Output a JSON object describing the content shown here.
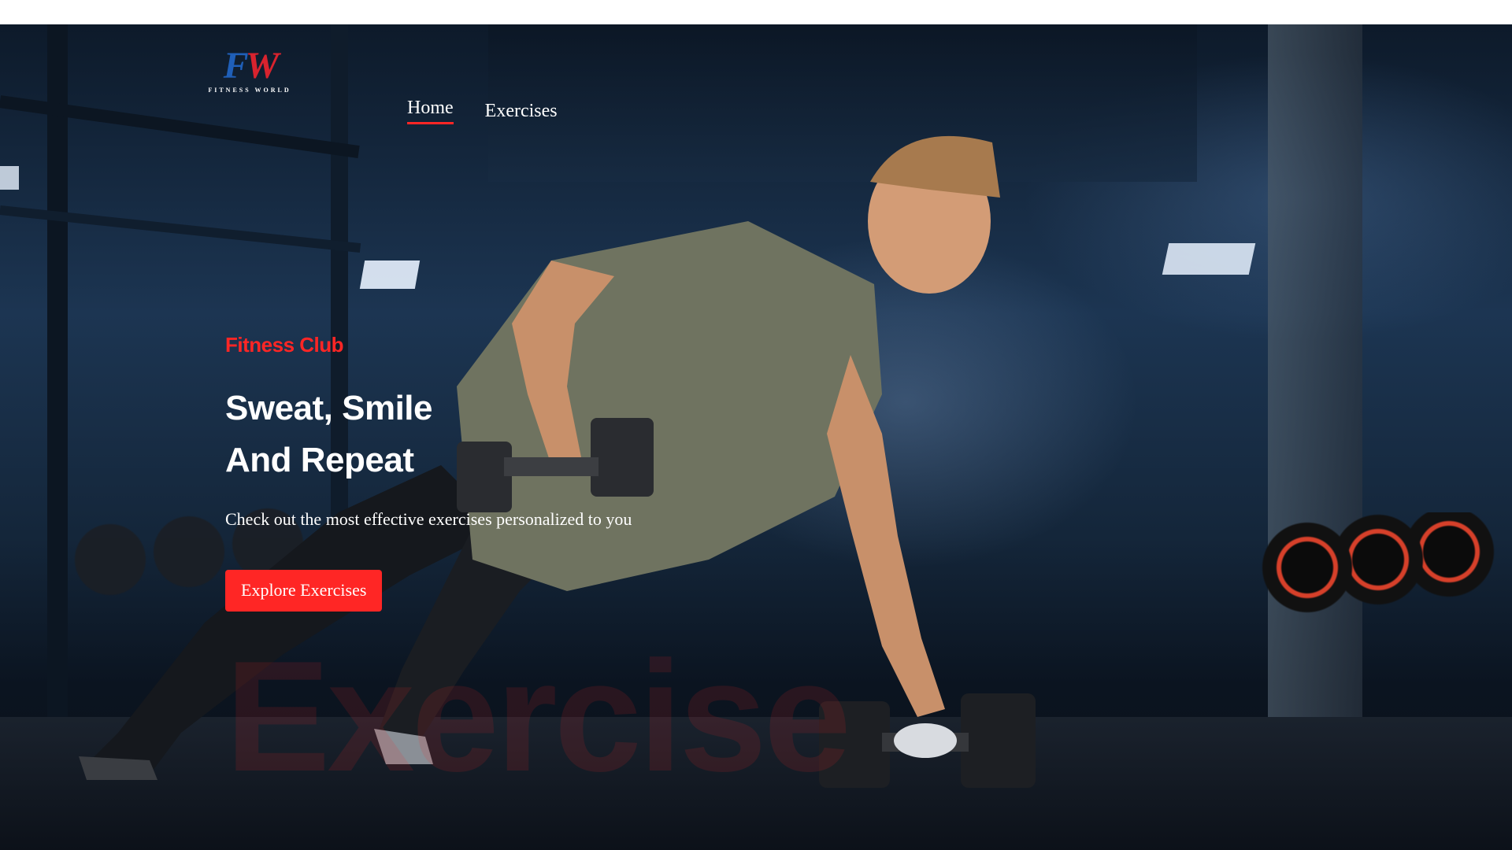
{
  "brand": {
    "logo_mark_f": "F",
    "logo_mark_w": "W",
    "logo_subtitle": "FITNESS WORLD",
    "colors": {
      "accent": "#ff2625",
      "logo_blue": "#1f5fb8",
      "logo_red": "#d8232e"
    }
  },
  "nav": {
    "items": [
      {
        "label": "Home",
        "active": true
      },
      {
        "label": "Exercises",
        "active": false
      }
    ]
  },
  "hero": {
    "subtitle": "Fitness Club",
    "headline_line1": "Sweat, Smile",
    "headline_line2": "And Repeat",
    "tagline": "Check out the most effective exercises personalized to you",
    "cta_label": "Explore Exercises",
    "watermark": "Exercise",
    "background_image": "athlete-doing-dumbbell-row-plank-in-gym"
  }
}
